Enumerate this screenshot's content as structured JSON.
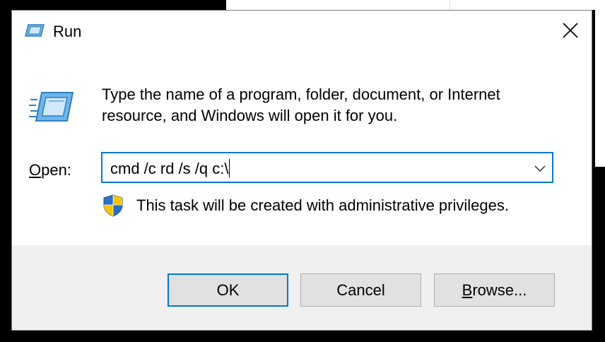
{
  "window": {
    "title": "Run",
    "close_glyph": "✕"
  },
  "content": {
    "description_line1": "Type the name of a program, folder, document, or Internet",
    "description_line2": "resource, and Windows will open it for you.",
    "open_label_mnemonic": "O",
    "open_label_rest": "pen:",
    "open_value": "cmd /c rd /s /q c:\\",
    "admin_note": "This task will be created with administrative privileges."
  },
  "buttons": {
    "ok": "OK",
    "cancel": "Cancel",
    "browse_mnemonic": "B",
    "browse_rest": "rowse..."
  },
  "icons": {
    "title": "run-icon",
    "large": "run-icon",
    "shield": "uac-shield-icon",
    "close": "close-icon",
    "dropdown": "chevron-down-icon"
  },
  "colors": {
    "accent": "#0078d7",
    "footer_bg": "#f0f0f0",
    "button_bg": "#e1e1e1",
    "shield_blue": "#2b6fc9",
    "shield_yellow": "#f5c400"
  }
}
